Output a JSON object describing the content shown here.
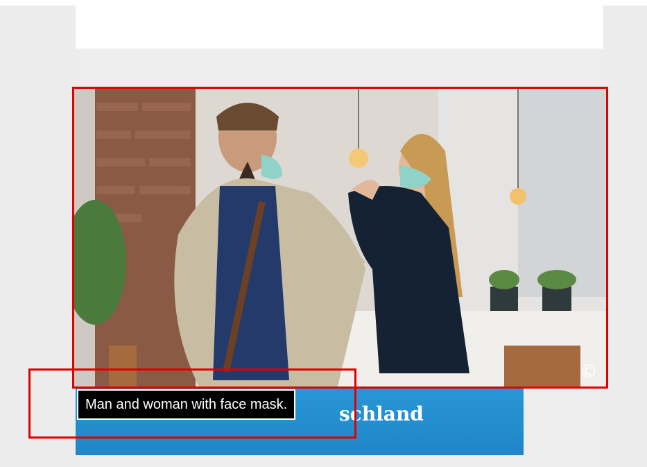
{
  "image": {
    "alt_tooltip": "Man and woman with face mask.",
    "copyright_symbol": "©"
  },
  "headline": {
    "visible_text": "schland"
  },
  "colors": {
    "highlight_border": "#e00000",
    "banner_blue": "#2b9ad8",
    "tooltip_bg": "#000000",
    "page_bg": "#ececec"
  }
}
